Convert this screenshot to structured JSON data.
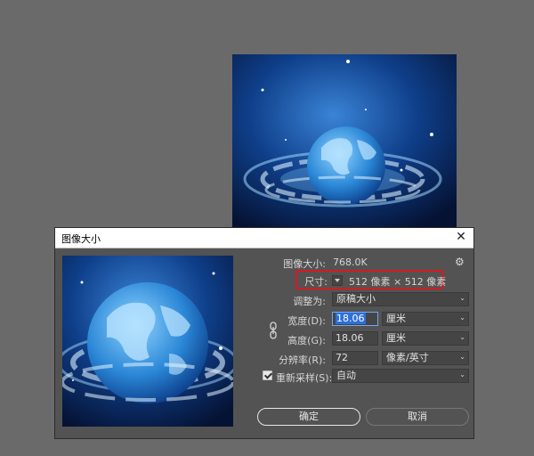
{
  "dialog": {
    "title": "图像大小",
    "close_glyph": "✕",
    "image_size_label": "图像大小:",
    "image_size_value": "768.0K",
    "dimensions_label": "尺寸:",
    "dimensions_value": "512 像素 × 512 像素",
    "fit_to_label": "调整为:",
    "fit_to_value": "原稿大小",
    "width_label": "宽度(D):",
    "width_value": "18.06",
    "width_unit": "厘米",
    "height_label": "高度(G):",
    "height_value": "18.06",
    "height_unit": "厘米",
    "resolution_label": "分辨率(R):",
    "resolution_value": "72",
    "resolution_unit": "像素/英寸",
    "resample_label": "重新采样(S):",
    "resample_checked": true,
    "resample_value": "自动",
    "ok_label": "确定",
    "cancel_label": "取消"
  },
  "colors": {
    "app_background": "#6a6a6a",
    "dialog_background": "#535353",
    "highlight_box": "#d71920",
    "selection": "#2f6fd6"
  }
}
